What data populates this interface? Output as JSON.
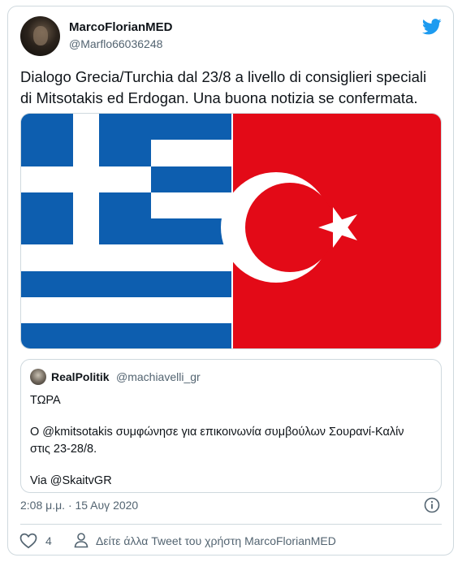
{
  "author": {
    "name": "MarcoFlorianMED",
    "handle": "@Marflo66036248"
  },
  "tweet": {
    "line1": "Dialogo Grecia/Turchia dal 23/8 a livello di consiglieri speciali",
    "line2": "di Mitsotakis ed Erdogan. Una buona notizia se confermata."
  },
  "media": {
    "description_icons": [
      "greek-flag",
      "turkish-flag"
    ]
  },
  "quoted": {
    "name": "RealPolitik",
    "handle": "@machiavelli_gr",
    "line1": "ΤΩΡΑ",
    "line2": "Ο @kmitsotakis συμφώνησε για επικοινωνία συμβούλων Σουρανί-Καλίν",
    "line3": "στις 23-28/8.",
    "line4": "Via @SkaitvGR"
  },
  "meta": {
    "timestamp": "2:08 μ.μ. · 15 Αυγ 2020"
  },
  "actions": {
    "like_count": "4",
    "more_label": "Δείτε άλλα Tweet του χρήστη MarcoFlorianMED"
  },
  "colors": {
    "greek_blue": "#0d5eaf",
    "turkish_red": "#e30a17",
    "twitter_blue": "#1d9bf0"
  }
}
